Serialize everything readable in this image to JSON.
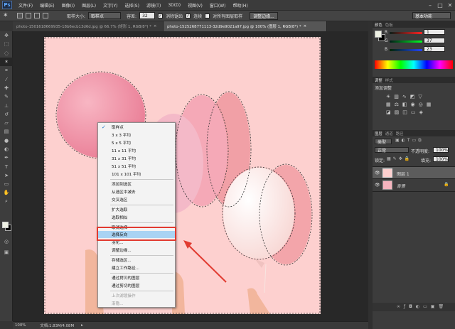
{
  "app": {
    "logo": "Ps"
  },
  "menu": [
    "文件(F)",
    "编辑(E)",
    "图像(I)",
    "图层(L)",
    "文字(Y)",
    "选择(S)",
    "滤镜(T)",
    "3D(D)",
    "视图(V)",
    "窗口(W)",
    "帮助(H)"
  ],
  "window_buttons": [
    "–",
    "□",
    "✕"
  ],
  "options": {
    "sample_size_label": "取样大小:",
    "sample_size_value": "取样点",
    "tolerance_label": "容差:",
    "tolerance_value": "32",
    "antialias_label": "消除锯齿",
    "contiguous_label": "连续",
    "sample_all_label": "对所有图层取样",
    "refine_button": "调整边缘...",
    "workspace": "基本功能"
  },
  "tabs": [
    {
      "label": "photo-1501618669935-18b6ecb13d6d.jpg @ 66.7% (矩形 1, RGB/8*) *",
      "close": "×"
    },
    {
      "label": "photo-1525268771113-32d9e9021a97.jpg @ 100% (图层 1, RGB/8*) *",
      "close": "×"
    }
  ],
  "status": {
    "zoom": "100%",
    "doc": "文档:1.83M/4.08M"
  },
  "panels": {
    "color_tabs": [
      "颜色",
      "色板"
    ],
    "rgb": [
      {
        "label": "R",
        "value": "1"
      },
      {
        "label": "G",
        "value": "37"
      },
      {
        "label": "B",
        "value": "23"
      }
    ],
    "adjust_tabs": [
      "调整",
      "样式"
    ],
    "adjust_title": "添加调整",
    "layers_tabs": [
      "图层",
      "通道",
      "路径"
    ],
    "filter_kind": "类型",
    "blend_mode": "正常",
    "opacity_label": "不透明度:",
    "opacity_value": "100%",
    "lock_label": "锁定:",
    "fill_label": "填充:",
    "fill_value": "100%",
    "layers": [
      {
        "name": "图层 1",
        "selected": true
      },
      {
        "name": "背景",
        "locked": true
      }
    ]
  },
  "context_menu": {
    "items": [
      {
        "label": "取样点",
        "checked": true
      },
      {
        "label": "3 x 3 平均"
      },
      {
        "label": "5 x 5 平均"
      },
      {
        "label": "11 x 11 平均"
      },
      {
        "label": "31 x 31 平均"
      },
      {
        "label": "51 x 51 平均"
      },
      {
        "label": "101 x 101 平均"
      },
      {
        "label": "添加到选区"
      },
      {
        "label": "从选区中减去"
      },
      {
        "label": "交叉选区"
      },
      {
        "label": "扩大选取"
      },
      {
        "label": "选取相似"
      },
      {
        "label": "取消选择"
      },
      {
        "label": "选择反向",
        "highlighted": true
      },
      {
        "label": "羽化..."
      },
      {
        "label": "调整边缘..."
      },
      {
        "label": "存储选区..."
      },
      {
        "label": "建立工作路径..."
      },
      {
        "label": "通过拷贝的图层"
      },
      {
        "label": "通过剪切的图层"
      },
      {
        "label": "上次滤镜操作",
        "disabled": true
      },
      {
        "label": "渐隐...",
        "disabled": true
      }
    ]
  },
  "colors": {
    "highlight": "#a9d3f3",
    "annotation": "#e13a30",
    "canvas_bg": "#fdd0cf"
  }
}
